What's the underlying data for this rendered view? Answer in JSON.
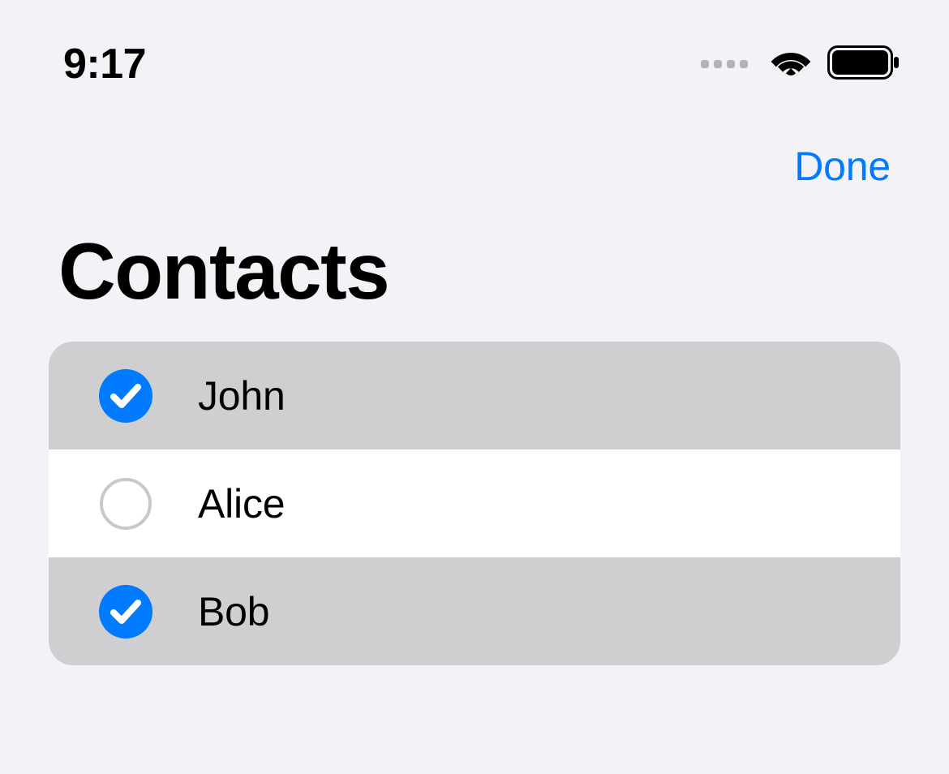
{
  "status": {
    "time": "9:17"
  },
  "nav": {
    "done_label": "Done"
  },
  "title": "Contacts",
  "colors": {
    "accent": "#007aff"
  },
  "contacts": [
    {
      "name": "John",
      "selected": true
    },
    {
      "name": "Alice",
      "selected": false
    },
    {
      "name": "Bob",
      "selected": true
    }
  ]
}
